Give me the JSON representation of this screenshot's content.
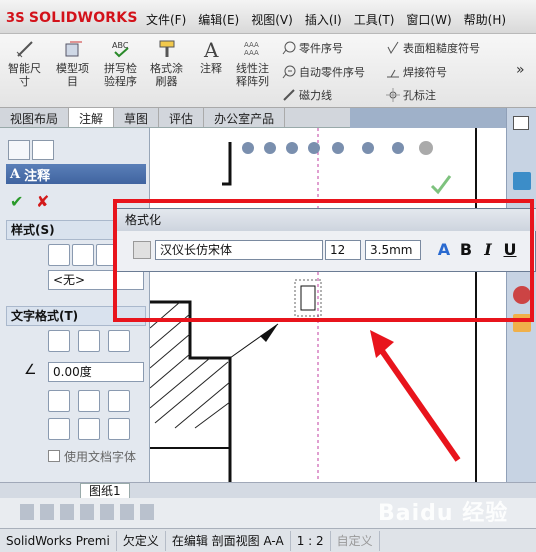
{
  "app": {
    "logo_text": "SOLIDWORKS",
    "logo_prefix": "3S"
  },
  "menu": [
    "文件(F)",
    "编辑(E)",
    "视图(V)",
    "插入(I)",
    "工具(T)",
    "窗口(W)",
    "帮助(H)"
  ],
  "ribbon": {
    "smart_dim": "智能尺\n寸",
    "model_items": "模型项\n目",
    "spell_check": "拼写检\n验程序",
    "format_painter": "格式涂\n刷器",
    "note": "注释",
    "linear_note_pattern": "线性注\n释阵列",
    "balloon": "零件序号",
    "auto_balloon": "自动零件序号",
    "magnetic_line": "磁力线",
    "surface_finish": "表面粗糙度符号",
    "weld_symbol": "焊接符号",
    "hole_callout": "孔标注",
    "more": "»"
  },
  "tabs": [
    "视图布局",
    "注解",
    "草图",
    "评估",
    "办公室产品"
  ],
  "active_tab": 1,
  "panel": {
    "title": "注释",
    "style_section": "样式(S)",
    "style_value": "<无>",
    "text_format_section": "文字格式(T)",
    "angle_value": "0.00度",
    "use_doc_font": "使用文档字体"
  },
  "format_toolbar": {
    "title": "格式化",
    "font": "汉仪长仿宋体",
    "size": "12",
    "height": "3.5mm",
    "bold": "B",
    "italic": "I",
    "underline": "U",
    "font_color_label": "A"
  },
  "sheet_tab": "图纸1",
  "status": {
    "app": "SolidWorks Premi",
    "underdefined": "欠定义",
    "editing": "在编辑 剖面视图 A-A",
    "scale": "1 : 2",
    "custom": "自定义"
  },
  "watermark": "Baidu 经验",
  "colors": {
    "accent_red": "#e8141c",
    "title_blue": "#4064a0",
    "brand_red": "#d3121a"
  }
}
